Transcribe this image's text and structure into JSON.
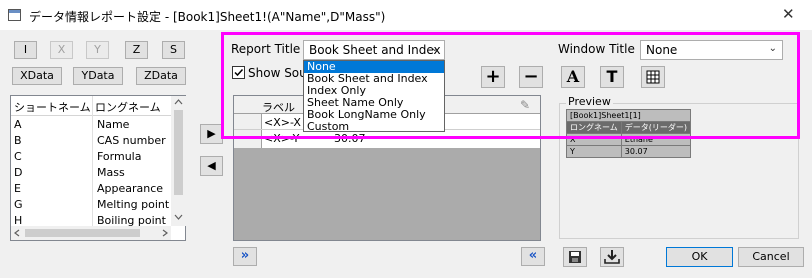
{
  "window": {
    "title": "データ情報レポート設定 - [Book1]Sheet1!(A\"Name\",D\"Mass\")",
    "close_glyph": "✕"
  },
  "axis_buttons": [
    "I",
    "X",
    "Y",
    "Z",
    "S"
  ],
  "data_buttons": [
    "XData",
    "YData",
    "ZData"
  ],
  "left_table": {
    "headers": [
      "ショートネーム",
      "ロングネーム"
    ],
    "rows": [
      [
        "A",
        "Name"
      ],
      [
        "B",
        "CAS number"
      ],
      [
        "C",
        "Formula"
      ],
      [
        "D",
        "Mass"
      ],
      [
        "E",
        "Appearance"
      ],
      [
        "G",
        "Melting point"
      ],
      [
        "H",
        "Boiling point"
      ]
    ]
  },
  "move_buttons": {
    "right": "▶",
    "left": "◀"
  },
  "report_title": {
    "label": "Report Title",
    "value": "Book Sheet and Index",
    "options": [
      "None",
      "Book Sheet and Index",
      "Index Only",
      "Sheet Name Only",
      "Book LongName Only",
      "Custom"
    ],
    "selected_option": "None"
  },
  "show_source": {
    "label": "Show Sour",
    "checked": true
  },
  "window_title": {
    "label": "Window Title",
    "value": "None"
  },
  "tool_buttons": {
    "add": "+",
    "remove": "−",
    "font": "A",
    "text": "T"
  },
  "grid": {
    "header_label": "ラベル",
    "rows": [
      {
        "label": "<X>-X",
        "value": ""
      },
      {
        "label": "<X>-Y",
        "value": "30.07"
      }
    ]
  },
  "preview": {
    "label": "Preview",
    "title": "[Book1]Sheet1[1]",
    "header": [
      "ロングネーム",
      "データ(リーダー)"
    ],
    "rows": [
      [
        "X",
        "Ethane"
      ],
      [
        "Y",
        "30.07"
      ]
    ]
  },
  "bottom": {
    "expand": "»",
    "collapse": "«",
    "ok": "OK",
    "cancel": "Cancel"
  },
  "colors": {
    "highlight": "#ff00ff",
    "selection": "#0078d7"
  }
}
